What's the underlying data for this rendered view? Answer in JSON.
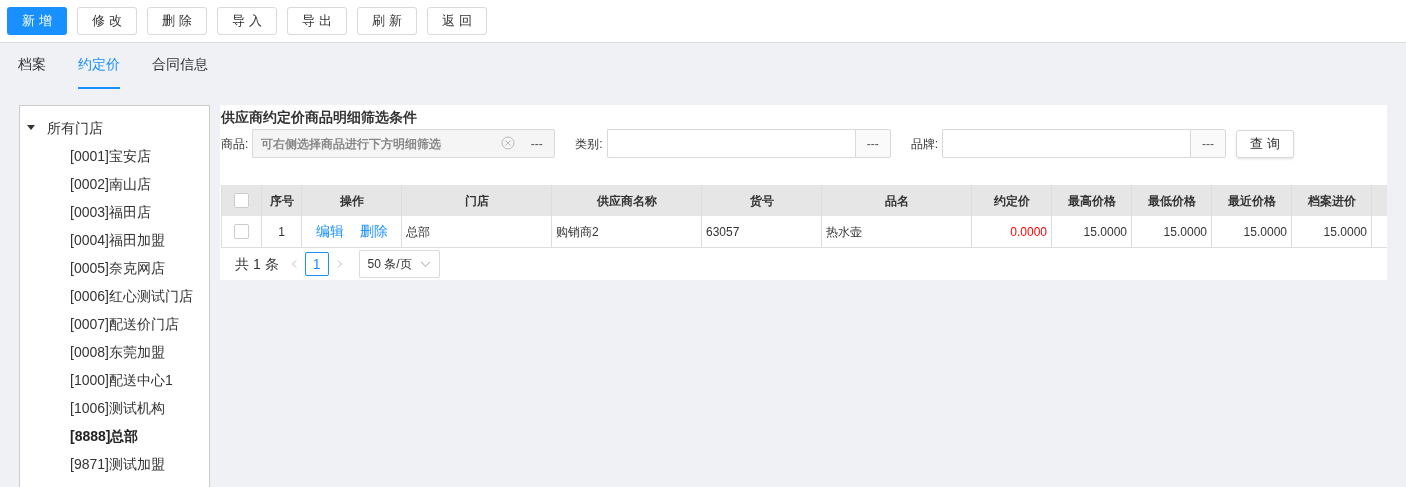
{
  "toolbar": [
    {
      "label": "新 增",
      "kind": "primary"
    },
    {
      "label": "修 改",
      "kind": "default"
    },
    {
      "label": "删 除",
      "kind": "default"
    },
    {
      "label": "导 入",
      "kind": "default"
    },
    {
      "label": "导 出",
      "kind": "default"
    },
    {
      "label": "刷 新",
      "kind": "default"
    },
    {
      "label": "返 回",
      "kind": "default"
    }
  ],
  "tabs": [
    {
      "label": "档案",
      "selected": false
    },
    {
      "label": "约定价",
      "selected": true
    },
    {
      "label": "合同信息",
      "selected": false
    }
  ],
  "tree": {
    "label": "所有门店",
    "expanded": true,
    "children": [
      {
        "label": "[0001]宝安店",
        "selected": false
      },
      {
        "label": "[0002]南山店",
        "selected": false
      },
      {
        "label": "[0003]福田店",
        "selected": false
      },
      {
        "label": "[0004]福田加盟",
        "selected": false
      },
      {
        "label": "[0005]奈克网店",
        "selected": false
      },
      {
        "label": "[0006]红心测试门店",
        "selected": false
      },
      {
        "label": "[0007]配送价门店",
        "selected": false
      },
      {
        "label": "[0008]东莞加盟",
        "selected": false
      },
      {
        "label": "[1000]配送中心1",
        "selected": false
      },
      {
        "label": "[1006]测试机构",
        "selected": false
      },
      {
        "label": "[8888]总部",
        "selected": true
      },
      {
        "label": "[9871]测试加盟",
        "selected": false
      }
    ]
  },
  "filter": {
    "title": "供应商约定价商品明细筛选条件",
    "fields": [
      {
        "label": "商品:",
        "placeholder": "可右侧选择商品进行下方明细筛选",
        "disabled": true,
        "browse": "---"
      },
      {
        "label": "类别:",
        "disabled": false,
        "browse": "---"
      },
      {
        "label": "品牌:",
        "disabled": false,
        "browse": "---"
      }
    ],
    "query_button": "查 询"
  },
  "table": {
    "all_checked": false,
    "columns": [
      {
        "label": "序号",
        "kind": "index"
      },
      {
        "label": "操作",
        "kind": "actions"
      },
      {
        "label": "门店",
        "kind": "text"
      },
      {
        "label": "供应商名称",
        "kind": "text"
      },
      {
        "label": "货号",
        "kind": "text"
      },
      {
        "label": "品名",
        "kind": "text"
      },
      {
        "label": "约定价",
        "kind": "alert"
      },
      {
        "label": "最高价格",
        "kind": "number"
      },
      {
        "label": "最低价格",
        "kind": "number"
      },
      {
        "label": "最近价格",
        "kind": "number"
      },
      {
        "label": "档案进价",
        "kind": "number"
      }
    ],
    "rows": [
      {
        "checked": false,
        "cells": [
          "1",
          [
            "编辑",
            "删除"
          ],
          "总部",
          "购销商2",
          "63057",
          "热水壶",
          "0.0000",
          "15.0000",
          "15.0000",
          "15.0000",
          "15.0000"
        ]
      }
    ]
  },
  "pagination": {
    "total": "共 1 条",
    "pages": [
      {
        "label": "1",
        "selected": true
      }
    ],
    "page_size": "50 条/页"
  }
}
